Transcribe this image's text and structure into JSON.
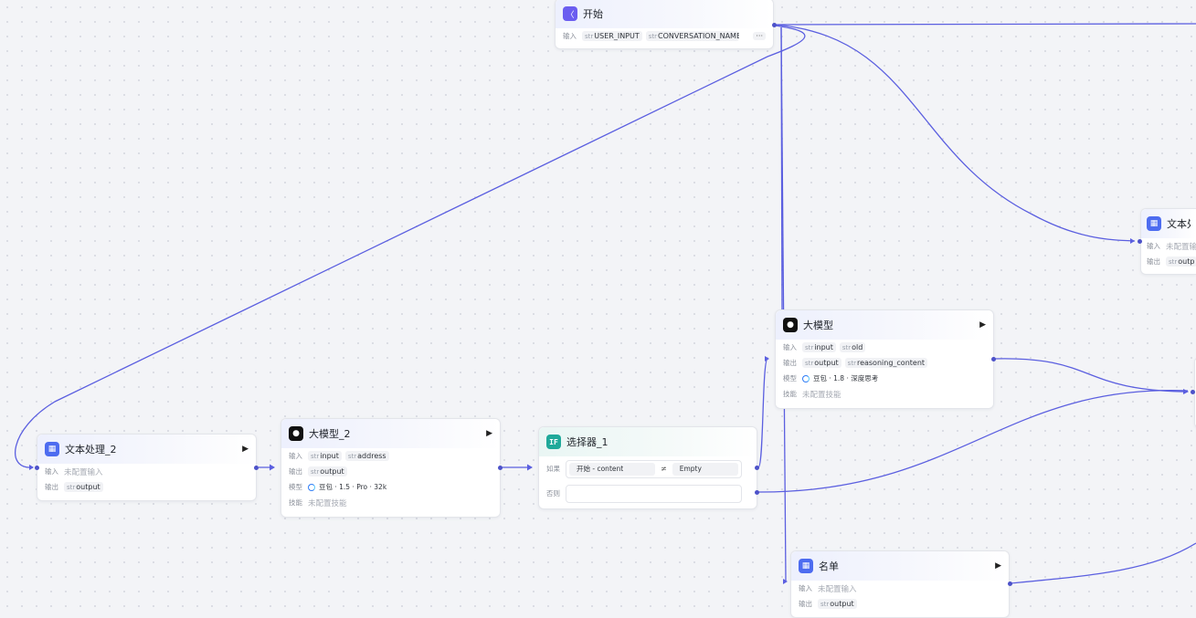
{
  "labels": {
    "input": "输入",
    "output": "输出",
    "model": "模型",
    "skill": "技能",
    "if": "如果",
    "else": "否则",
    "not_configured_input": "未配置输入",
    "not_configured_skill": "未配置技能",
    "str": "str"
  },
  "nodes": {
    "start": {
      "title": "开始",
      "inputs": [
        "USER_INPUT",
        "CONVERSATION_NAME"
      ],
      "more": "···"
    },
    "text_proc_2": {
      "title": "文本处理_2",
      "output": "output"
    },
    "llm_2": {
      "title": "大模型_2",
      "inputs": [
        "input",
        "address"
      ],
      "output": "output",
      "model": "豆包 · 1.5 · Pro · 32k"
    },
    "selector_1": {
      "title": "选择器_1",
      "icon_text": "IF",
      "cond_left": "开始  -  content",
      "cond_op": "≠",
      "cond_right": "Empty"
    },
    "llm": {
      "title": "大模型",
      "inputs": [
        "input",
        "old"
      ],
      "outputs": [
        "output",
        "reasoning_content"
      ],
      "model": "豆包 · 1.8 · 深度思考"
    },
    "text_proc_right": {
      "title": "文本处",
      "input_hint": "未配置输",
      "output": "outp"
    },
    "list": {
      "title": "名单",
      "output": "output"
    }
  },
  "colors": {
    "edge": "#5b5fe0",
    "accent": "#4d6cf0",
    "teal": "#1fa99a"
  }
}
